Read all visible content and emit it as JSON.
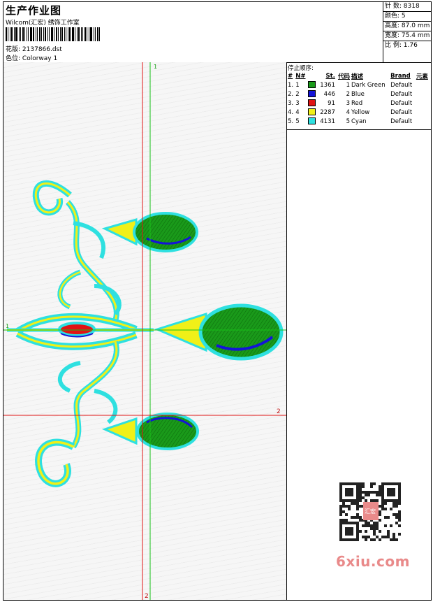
{
  "header": {
    "title": "生产作业图",
    "company": "Wilcom(汇宏) 绣饰工作室",
    "design_file_label": "花版:",
    "design_file": "2137866.dst",
    "colorway_label": "色位:",
    "colorway": "Colorway 1"
  },
  "stats": [
    {
      "label": "针 数:",
      "value": "8318"
    },
    {
      "label": "颜色:",
      "value": "5"
    },
    {
      "label": "高度:",
      "value": "87.0 mm"
    },
    {
      "label": "宽度:",
      "value": "75.4 mm"
    },
    {
      "label": "比 例:",
      "value": "1.76"
    }
  ],
  "legend": {
    "title": "停止顺序:",
    "headers": [
      "#",
      "N#",
      "St.",
      "代码",
      "描述",
      "Brand",
      "元素"
    ],
    "rows": [
      {
        "index": "1.",
        "n": "1",
        "color": "#1a9a1a",
        "stitches": "1361",
        "code": "1",
        "description": "Dark Green",
        "brand": "Default"
      },
      {
        "index": "2.",
        "n": "2",
        "color": "#1414d8",
        "stitches": "446",
        "code": "2",
        "description": "Blue",
        "brand": "Default"
      },
      {
        "index": "3.",
        "n": "3",
        "color": "#e01414",
        "stitches": "91",
        "code": "3",
        "description": "Red",
        "brand": "Default"
      },
      {
        "index": "4.",
        "n": "4",
        "color": "#f0f018",
        "stitches": "2287",
        "code": "4",
        "description": "Yellow",
        "brand": "Default"
      },
      {
        "index": "5.",
        "n": "5",
        "color": "#2ee0e0",
        "stitches": "4131",
        "code": "5",
        "description": "Cyan",
        "brand": "Default"
      }
    ]
  },
  "guides": {
    "vertical_top_label": "1",
    "vertical_bottom_label": "2",
    "horizontal_right_label": "2",
    "horizontal_left_label": "1"
  },
  "watermark": {
    "text": "6xiu.com",
    "seal_text": "汇宏"
  },
  "colors": {
    "green": "#1a9a1a",
    "blue": "#1414d8",
    "red": "#e01414",
    "yellow": "#f0f018",
    "cyan": "#2ee0e0",
    "guide_red": "#e01414",
    "guide_green": "#18c018"
  }
}
